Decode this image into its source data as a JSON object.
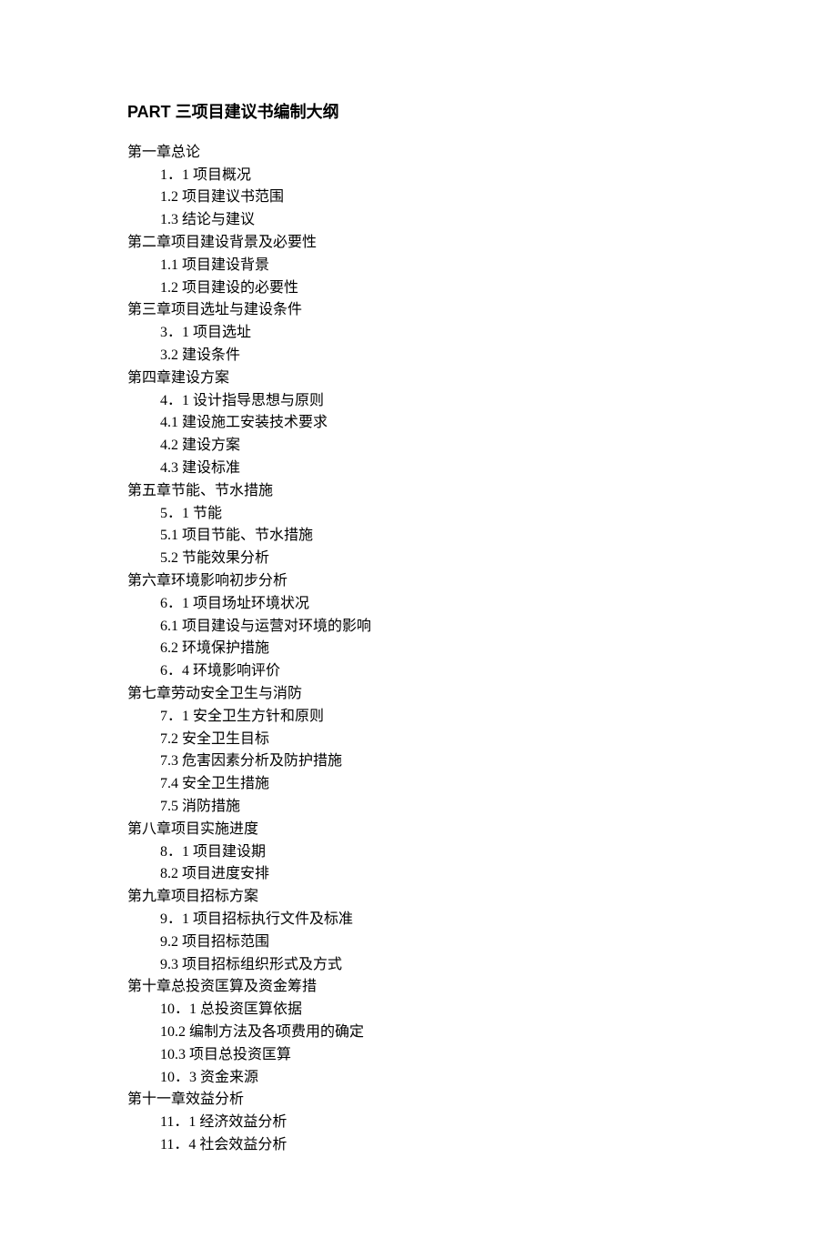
{
  "title": "PART 三项目建议书编制大纲",
  "chapters": [
    {
      "heading": "第一章总论",
      "items": [
        "1．1 项目概况",
        "1.2 项目建议书范围",
        "1.3 结论与建议"
      ]
    },
    {
      "heading": "第二章项目建设背景及必要性",
      "items": [
        "1.1    项目建设背景",
        "1.2    项目建设的必要性"
      ]
    },
    {
      "heading": "第三章项目选址与建设条件",
      "items": [
        "3．1 项目选址",
        "3.2 建设条件"
      ]
    },
    {
      "heading": "第四章建设方案",
      "items": [
        "4．1 设计指导思想与原则",
        "4.1    建设施工安装技术要求",
        "4.2    建设方案",
        "4.3    建设标准"
      ]
    },
    {
      "heading": "第五章节能、节水措施",
      "items": [
        "5．1 节能",
        "5.1    项目节能、节水措施",
        "5.2    节能效果分析"
      ]
    },
    {
      "heading": "第六章环境影响初步分析",
      "items": [
        "6．1 项目场址环境状况",
        "6.1    项目建设与运营对环境的影响",
        "6.2    环境保护措施",
        "6．4 环境影响评价"
      ]
    },
    {
      "heading": "第七章劳动安全卫生与消防",
      "items": [
        "7．1 安全卫生方针和原则",
        "7.2    安全卫生目标",
        "7.3    危害因素分析及防护措施",
        "7.4    安全卫生措施",
        "7.5    消防措施"
      ]
    },
    {
      "heading": "第八章项目实施进度",
      "items": [
        "8．1 项目建设期",
        "8.2 项目进度安排"
      ]
    },
    {
      "heading": "第九章项目招标方案",
      "items": [
        "9．1 项目招标执行文件及标准",
        "9.2    项目招标范围",
        "9.3    项目招标组织形式及方式"
      ]
    },
    {
      "heading": "第十章总投资匡算及资金筹措",
      "items": [
        "10．1 总投资匡算依据",
        "10.2    编制方法及各项费用的确定",
        "10.3    项目总投资匡算",
        "10．3 资金来源"
      ]
    },
    {
      "heading": "第十一章效益分析",
      "items": [
        "11．1 经济效益分析",
        "11．4 社会效益分析"
      ]
    }
  ]
}
